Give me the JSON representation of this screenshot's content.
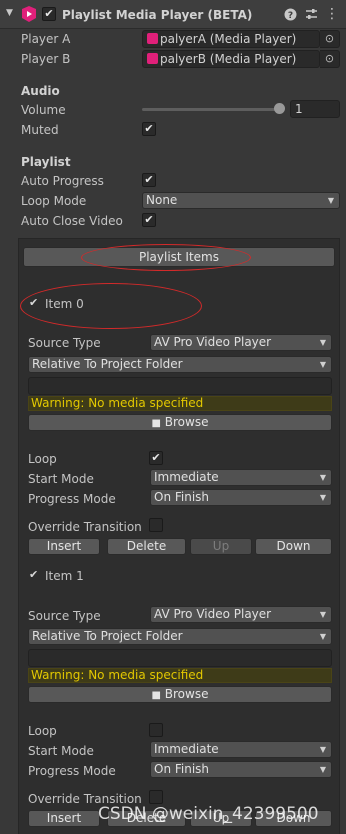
{
  "component": {
    "title": "Playlist Media Player (BETA)",
    "enabled": true,
    "help_icon": "help-icon",
    "settings_icon": "preset-icon",
    "menu_icon": "kebab-menu-icon"
  },
  "players": {
    "player_a_label": "Player A",
    "player_a_value": "palyerA (Media Player)",
    "player_b_label": "Player B",
    "player_b_value": "palyerB (Media Player)"
  },
  "audio": {
    "header": "Audio",
    "volume_label": "Volume",
    "volume_value": "1",
    "volume_level": 1.0,
    "muted_label": "Muted",
    "muted": true
  },
  "playlist": {
    "header": "Playlist",
    "auto_progress_label": "Auto Progress",
    "auto_progress": true,
    "loop_mode_label": "Loop Mode",
    "loop_mode_value": "None",
    "auto_close_label": "Auto Close Video",
    "auto_close": true,
    "items_button": "Playlist Items"
  },
  "items": [
    {
      "name": "Item 0",
      "enabled": true,
      "source_type_label": "Source Type",
      "source_type_value": "AV Pro Video Player",
      "path_mode": "Relative To Project Folder",
      "path_value": "",
      "warning": "Warning: No media specified",
      "browse": "Browse",
      "loop_label": "Loop",
      "loop": true,
      "start_mode_label": "Start Mode",
      "start_mode_value": "Immediate",
      "progress_mode_label": "Progress Mode",
      "progress_mode_value": "On Finish",
      "override_label": "Override Transition",
      "override": false,
      "insert": "Insert",
      "delete": "Delete",
      "up": "Up",
      "down": "Down"
    },
    {
      "name": "Item 1",
      "enabled": true,
      "source_type_label": "Source Type",
      "source_type_value": "AV Pro Video Player",
      "path_mode": "Relative To Project Folder",
      "path_value": "",
      "warning": "Warning: No media specified",
      "browse": "Browse",
      "loop_label": "Loop",
      "loop": false,
      "start_mode_label": "Start Mode",
      "start_mode_value": "Immediate",
      "progress_mode_label": "Progress Mode",
      "progress_mode_value": "On Finish",
      "override_label": "Override Transition",
      "override": false,
      "insert": "Insert",
      "delete": "Delete",
      "up": "Up",
      "down": "Down"
    }
  ],
  "watermark": "CSDN @weixin_42399500",
  "colors": {
    "background": "#383838",
    "annotation": "#d32a2a",
    "warning_text": "#e3c800"
  }
}
